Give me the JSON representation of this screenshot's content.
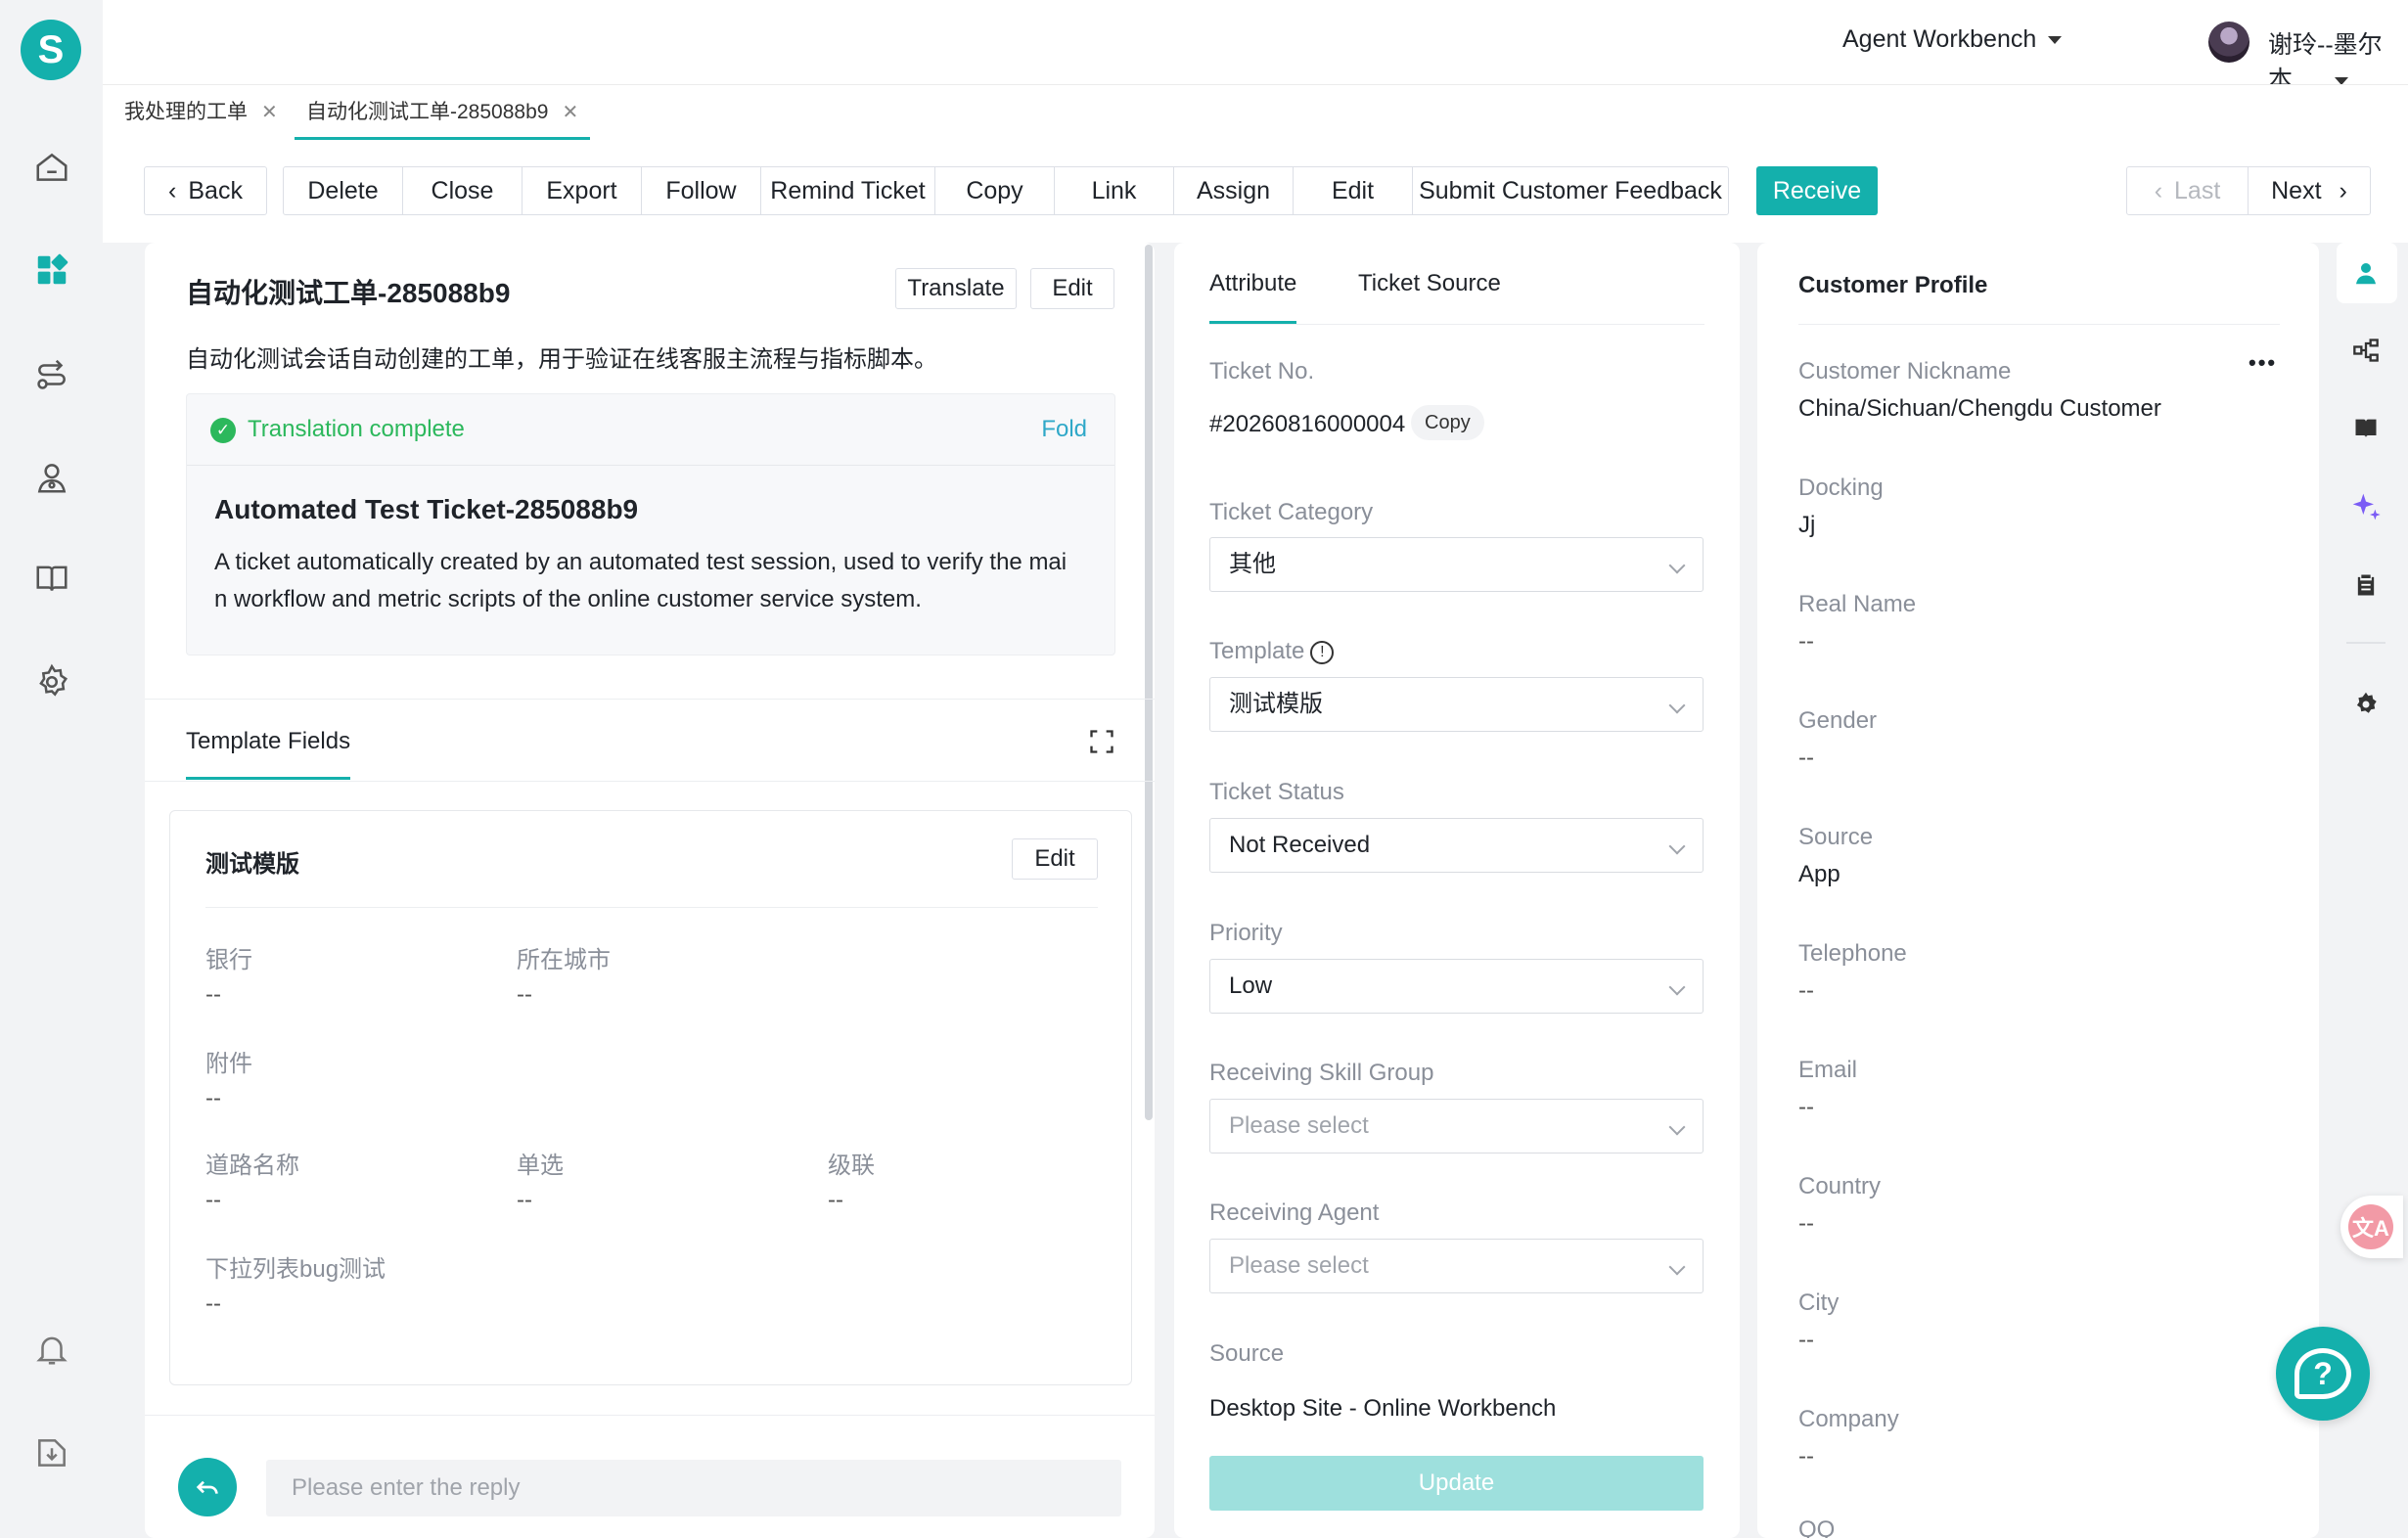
{
  "header": {
    "workbench_label": "Agent Workbench",
    "user_name": "谢玲--墨尔本..."
  },
  "tabs": [
    {
      "label": "我处理的工单"
    },
    {
      "label": "自动化测试工单-285088b9"
    }
  ],
  "toolbar": {
    "back": "Back",
    "actions": [
      "Delete",
      "Close",
      "Export",
      "Follow",
      "Remind Ticket",
      "Copy",
      "Link",
      "Assign",
      "Edit",
      "Submit Customer Feedback"
    ],
    "receive": "Receive",
    "last": "Last",
    "next": "Next"
  },
  "ticket": {
    "title": "自动化测试工单-285088b9",
    "translate_btn": "Translate",
    "edit_btn": "Edit",
    "description": "自动化测试会话自动创建的工单，用于验证在线客服主流程与指标脚本。",
    "translation_status": "Translation complete",
    "fold": "Fold",
    "translated_title": "Automated Test Ticket-285088b9",
    "translated_body_1": "A ticket automatically created by an automated test session, used to verify the mai",
    "translated_body_2": "n workflow and metric scripts of the online customer service system."
  },
  "template_fields": {
    "tab_label": "Template Fields",
    "card_title": "测试模版",
    "edit_btn": "Edit",
    "fields": [
      {
        "label": "银行",
        "value": "--"
      },
      {
        "label": "所在城市",
        "value": "--"
      },
      {
        "label": "附件",
        "value": "--"
      },
      {
        "label": "道路名称",
        "value": "--"
      },
      {
        "label": "单选",
        "value": "--"
      },
      {
        "label": "级联",
        "value": "--"
      },
      {
        "label": "下拉列表bug测试",
        "value": "--"
      }
    ]
  },
  "reply": {
    "placeholder": "Please enter the reply"
  },
  "attribute": {
    "tab_attribute": "Attribute",
    "tab_source": "Ticket Source",
    "ticket_no_label": "Ticket No.",
    "ticket_no": "#20260816000004",
    "copy": "Copy",
    "category_label": "Ticket Category",
    "category": "其他",
    "template_label": "Template",
    "template": "测试模版",
    "status_label": "Ticket Status",
    "status": "Not Received",
    "priority_label": "Priority",
    "priority": "Low",
    "skill_group_label": "Receiving Skill Group",
    "skill_group_placeholder": "Please select",
    "agent_label": "Receiving Agent",
    "agent_placeholder": "Please select",
    "source_label": "Source",
    "source": "Desktop Site - Online Workbench",
    "update": "Update"
  },
  "customer": {
    "title": "Customer Profile",
    "more": "•••",
    "fields": [
      {
        "label": "Customer Nickname",
        "value": "China/Sichuan/Chengdu Customer"
      },
      {
        "label": "Docking",
        "value": "Jj"
      },
      {
        "label": "Real Name",
        "value": "--"
      },
      {
        "label": "Gender",
        "value": "--"
      },
      {
        "label": "Source",
        "value": "App"
      },
      {
        "label": "Telephone",
        "value": "--"
      },
      {
        "label": "Email",
        "value": "--"
      },
      {
        "label": "Country",
        "value": "--"
      },
      {
        "label": "City",
        "value": "--"
      },
      {
        "label": "Company",
        "value": "--"
      },
      {
        "label": "QQ",
        "value": ""
      }
    ]
  },
  "colors": {
    "accent": "#14b0ac",
    "success": "#2cb85c",
    "link": "#2fa8c8"
  }
}
